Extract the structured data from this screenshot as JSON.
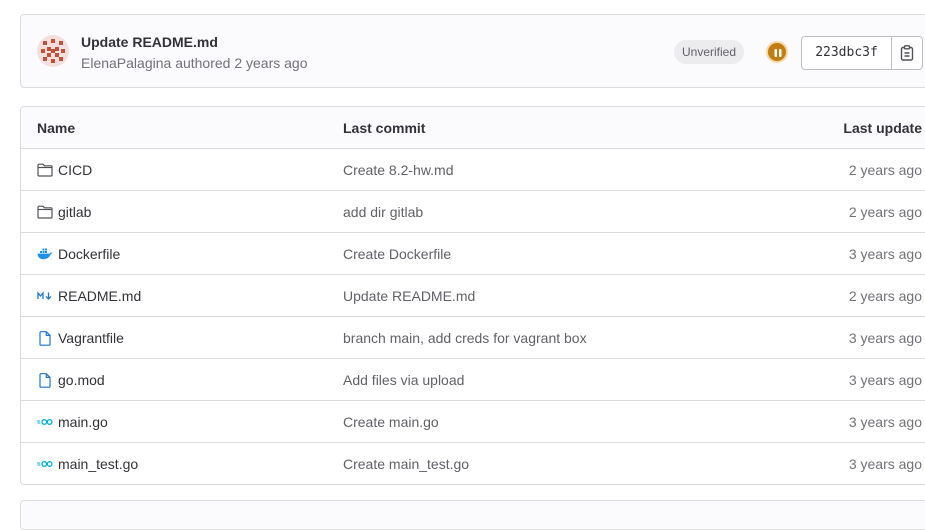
{
  "commit": {
    "title": "Update README.md",
    "author": "ElenaPalagina",
    "authored_text": "authored 2 years ago",
    "verification": "Unverified",
    "sha": "223dbc3f",
    "pipeline_status": "paused"
  },
  "table": {
    "headers": {
      "name": "Name",
      "last_commit": "Last commit",
      "last_update": "Last update"
    },
    "rows": [
      {
        "icon": "folder-icon",
        "name": "CICD",
        "commit": "Create 8.2-hw.md",
        "updated": "2 years ago"
      },
      {
        "icon": "folder-icon",
        "name": "gitlab",
        "commit": "add dir gitlab",
        "updated": "2 years ago"
      },
      {
        "icon": "docker-icon",
        "name": "Dockerfile",
        "commit": "Create Dockerfile",
        "updated": "3 years ago"
      },
      {
        "icon": "markdown-icon",
        "name": "README.md",
        "commit": "Update README.md",
        "updated": "2 years ago"
      },
      {
        "icon": "file-icon",
        "name": "Vagrantfile",
        "commit": "branch main, add creds for vagrant box",
        "updated": "3 years ago"
      },
      {
        "icon": "file-icon",
        "name": "go.mod",
        "commit": "Add files via upload",
        "updated": "3 years ago"
      },
      {
        "icon": "go-icon",
        "name": "main.go",
        "commit": "Create main.go",
        "updated": "3 years ago"
      },
      {
        "icon": "go-icon",
        "name": "main_test.go",
        "commit": "Create main_test.go",
        "updated": "3 years ago"
      }
    ]
  },
  "colors": {
    "link_blue": "#1f75cb",
    "pipeline_paused": "#c17d10",
    "go_cyan": "#00add8",
    "docker_blue": "#1d91e6"
  }
}
